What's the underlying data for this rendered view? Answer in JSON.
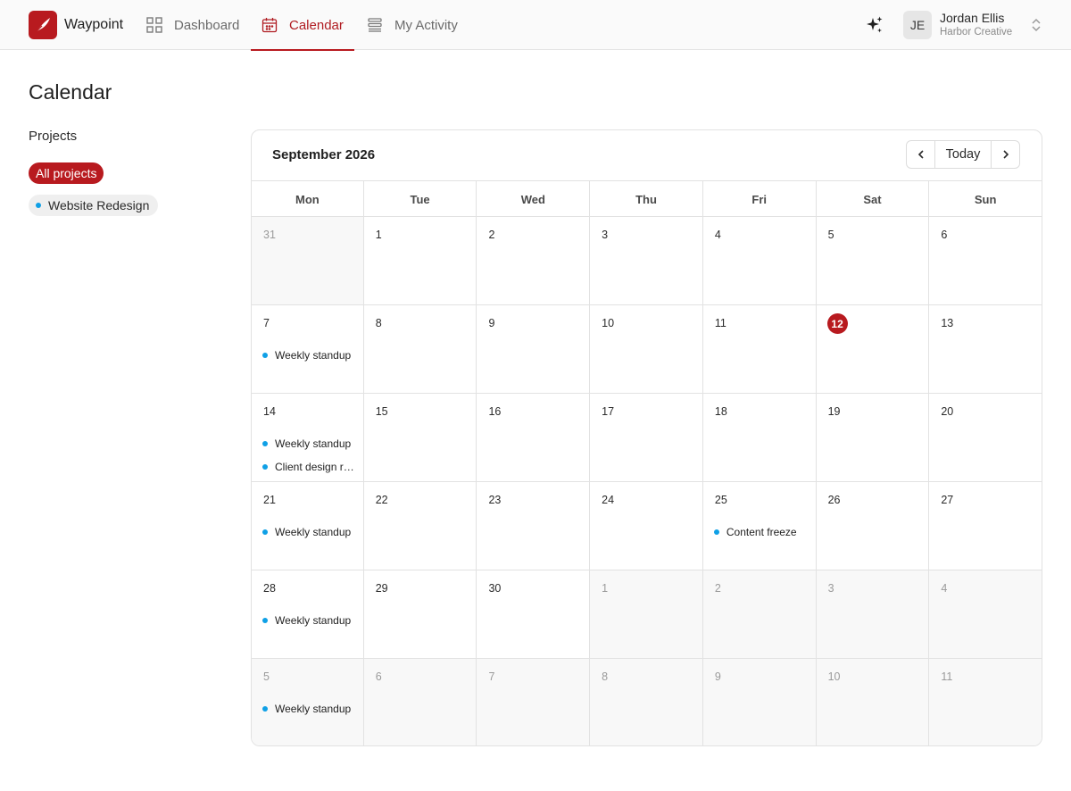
{
  "app": {
    "name": "Waypoint"
  },
  "nav": {
    "tabs": [
      {
        "label": "Dashboard",
        "icon": "dashboard-grid-icon",
        "active": false
      },
      {
        "label": "Calendar",
        "icon": "calendar-icon",
        "active": true
      },
      {
        "label": "My Activity",
        "icon": "activity-list-icon",
        "active": false
      }
    ]
  },
  "user": {
    "initials": "JE",
    "name": "Jordan Ellis",
    "org": "Harbor Creative"
  },
  "page": {
    "title": "Calendar"
  },
  "projects": {
    "label": "Projects",
    "filters": [
      {
        "label": "All projects",
        "selected": true
      },
      {
        "label": "Website Redesign",
        "selected": false,
        "color": "#0fa0e6"
      }
    ]
  },
  "calendar": {
    "month_label": "September 2026",
    "today_label": "Today",
    "weekdays": [
      "Mon",
      "Tue",
      "Wed",
      "Thu",
      "Fri",
      "Sat",
      "Sun"
    ],
    "weeks": [
      [
        {
          "day": "31",
          "out": true,
          "events": []
        },
        {
          "day": "1",
          "events": []
        },
        {
          "day": "2",
          "events": []
        },
        {
          "day": "3",
          "events": []
        },
        {
          "day": "4",
          "events": []
        },
        {
          "day": "5",
          "events": []
        },
        {
          "day": "6",
          "events": []
        }
      ],
      [
        {
          "day": "7",
          "events": [
            "Weekly standup"
          ]
        },
        {
          "day": "8",
          "events": []
        },
        {
          "day": "9",
          "events": []
        },
        {
          "day": "10",
          "events": []
        },
        {
          "day": "11",
          "events": []
        },
        {
          "day": "12",
          "today": true,
          "events": []
        },
        {
          "day": "13",
          "events": []
        }
      ],
      [
        {
          "day": "14",
          "events": [
            "Weekly standup",
            "Client design review"
          ]
        },
        {
          "day": "15",
          "events": []
        },
        {
          "day": "16",
          "events": []
        },
        {
          "day": "17",
          "events": []
        },
        {
          "day": "18",
          "events": []
        },
        {
          "day": "19",
          "events": []
        },
        {
          "day": "20",
          "events": []
        }
      ],
      [
        {
          "day": "21",
          "events": [
            "Weekly standup"
          ]
        },
        {
          "day": "22",
          "events": []
        },
        {
          "day": "23",
          "events": []
        },
        {
          "day": "24",
          "events": []
        },
        {
          "day": "25",
          "events": [
            "Content freeze"
          ]
        },
        {
          "day": "26",
          "events": []
        },
        {
          "day": "27",
          "events": []
        }
      ],
      [
        {
          "day": "28",
          "events": [
            "Weekly standup"
          ]
        },
        {
          "day": "29",
          "events": []
        },
        {
          "day": "30",
          "events": []
        },
        {
          "day": "1",
          "out": true,
          "events": []
        },
        {
          "day": "2",
          "out": true,
          "events": []
        },
        {
          "day": "3",
          "out": true,
          "events": []
        },
        {
          "day": "4",
          "out": true,
          "events": []
        }
      ],
      [
        {
          "day": "5",
          "out": true,
          "events": [
            "Weekly standup"
          ]
        },
        {
          "day": "6",
          "out": true,
          "events": []
        },
        {
          "day": "7",
          "out": true,
          "events": []
        },
        {
          "day": "8",
          "out": true,
          "events": []
        },
        {
          "day": "9",
          "out": true,
          "events": []
        },
        {
          "day": "10",
          "out": true,
          "events": []
        },
        {
          "day": "11",
          "out": true,
          "events": []
        }
      ]
    ]
  },
  "colors": {
    "accent": "#b81a1f",
    "event_dot": "#0fa0e6"
  }
}
